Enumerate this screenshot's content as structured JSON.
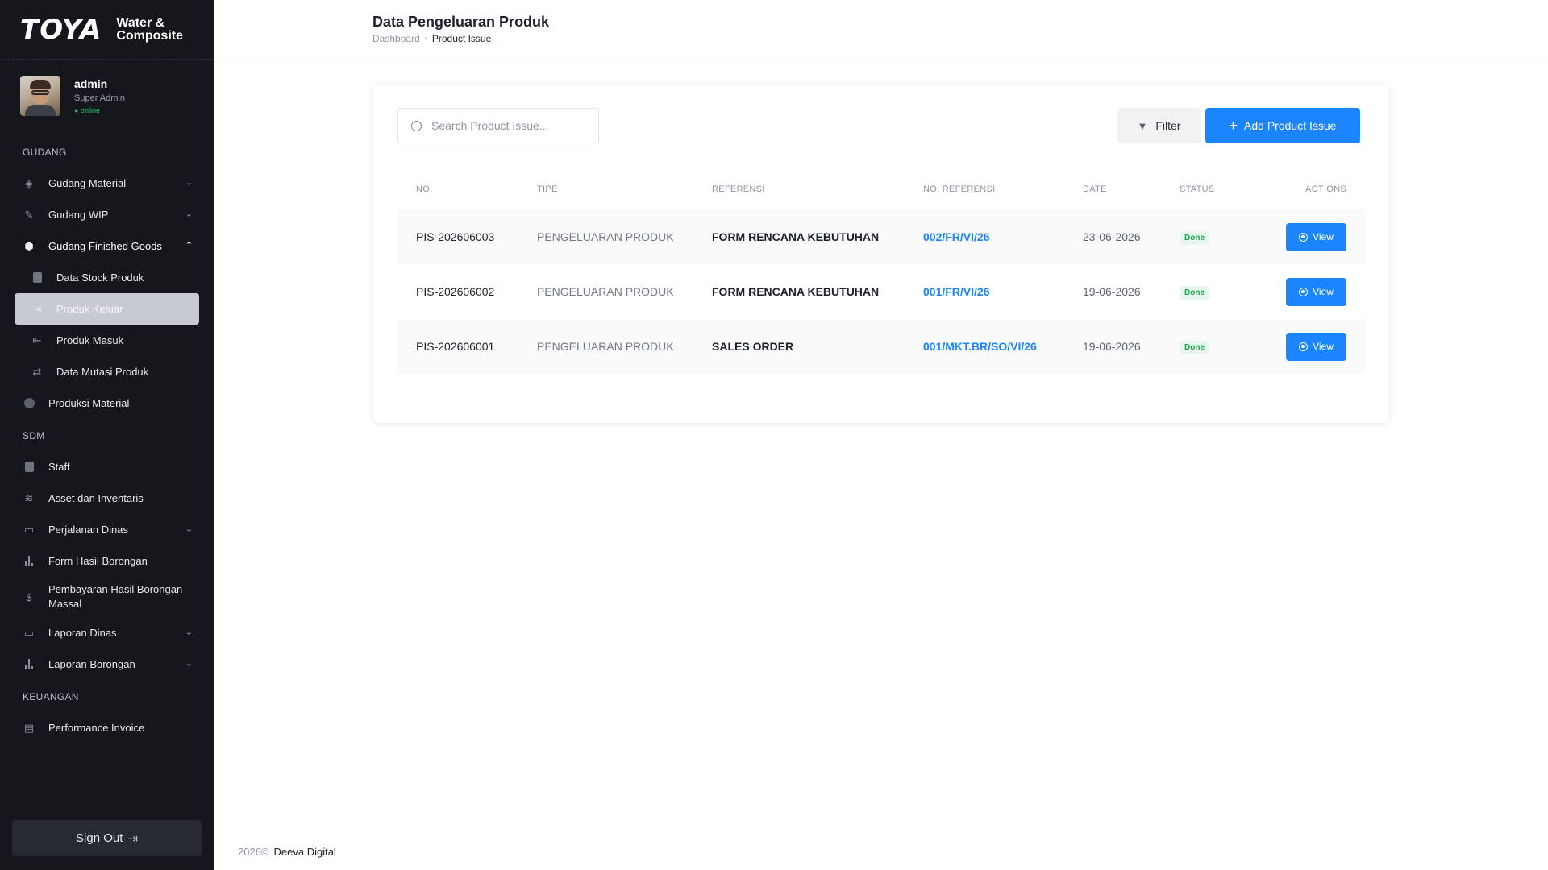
{
  "brand": {
    "logo": "TOYA",
    "subtitle_line1": "Water &",
    "subtitle_line2": "Composite"
  },
  "user": {
    "name": "admin",
    "role": "Super Admin",
    "status": "● online"
  },
  "sidebar": {
    "gudang_title": "GUDANG",
    "gudang": [
      {
        "label": "Gudang Material",
        "icon": "cube-icon"
      },
      {
        "label": "Gudang WIP",
        "icon": "wrench-icon"
      },
      {
        "label": "Gudang Finished Goods",
        "icon": "box-icon"
      }
    ],
    "finished_goods": [
      {
        "label": "Data Stock Produk",
        "icon": "stock-icon"
      },
      {
        "label": "Produk Keluar",
        "icon": "exit-icon"
      },
      {
        "label": "Produk Masuk",
        "icon": "enter-icon"
      },
      {
        "label": "Data Mutasi Produk",
        "icon": "transfer-icon"
      }
    ],
    "produksi": {
      "label": "Produksi Material",
      "icon": "production-icon"
    },
    "sdm_title": "SDM",
    "sdm": [
      {
        "label": "Staff",
        "icon": "staff-icon"
      },
      {
        "label": "Asset dan Inventaris",
        "icon": "layers-icon"
      },
      {
        "label": "Perjalanan Dinas",
        "icon": "car-icon"
      },
      {
        "label": "Form Hasil Borongan",
        "icon": "chart-icon"
      },
      {
        "label": "Pembayaran Hasil Borongan Massal",
        "icon": "dollar-icon"
      },
      {
        "label": "Laporan Dinas",
        "icon": "car-icon"
      },
      {
        "label": "Laporan Borongan",
        "icon": "chart-icon"
      }
    ],
    "keuangan_title": "KEUANGAN",
    "keuangan": [
      {
        "label": "Performance Invoice",
        "icon": "invoice-icon"
      }
    ],
    "signout": "Sign Out"
  },
  "header": {
    "title": "Data Pengeluaran Produk",
    "breadcrumb": {
      "home": "Dashboard",
      "current": "Product Issue"
    }
  },
  "toolbar": {
    "search_placeholder": "Search Product Issue...",
    "filter_label": "Filter",
    "add_label": "Add Product Issue"
  },
  "table": {
    "columns": [
      "NO.",
      "TIPE",
      "REFERENSI",
      "NO. REFERENSI",
      "DATE",
      "STATUS",
      "ACTIONS"
    ],
    "rows": [
      {
        "no": "PIS-202606003",
        "tipe": "PENGELUARAN PRODUK",
        "referensi": "FORM RENCANA KEBUTUHAN",
        "no_referensi": "002/FR/VI/26",
        "date": "23-06-2026",
        "status": "Done",
        "action": "View"
      },
      {
        "no": "PIS-202606002",
        "tipe": "PENGELUARAN PRODUK",
        "referensi": "FORM RENCANA KEBUTUHAN",
        "no_referensi": "001/FR/VI/26",
        "date": "19-06-2026",
        "status": "Done",
        "action": "View"
      },
      {
        "no": "PIS-202606001",
        "tipe": "PENGELUARAN PRODUK",
        "referensi": "SALES ORDER",
        "no_referensi": "001/MKT.BR/SO/VI/26",
        "date": "19-06-2026",
        "status": "Done",
        "action": "View"
      }
    ]
  },
  "footer": {
    "year": "2026©",
    "company": "Deeva Digital"
  },
  "colors": {
    "primary": "#1b84ff",
    "sidebar_bg": "#15171c",
    "success": "#1ea54c"
  }
}
